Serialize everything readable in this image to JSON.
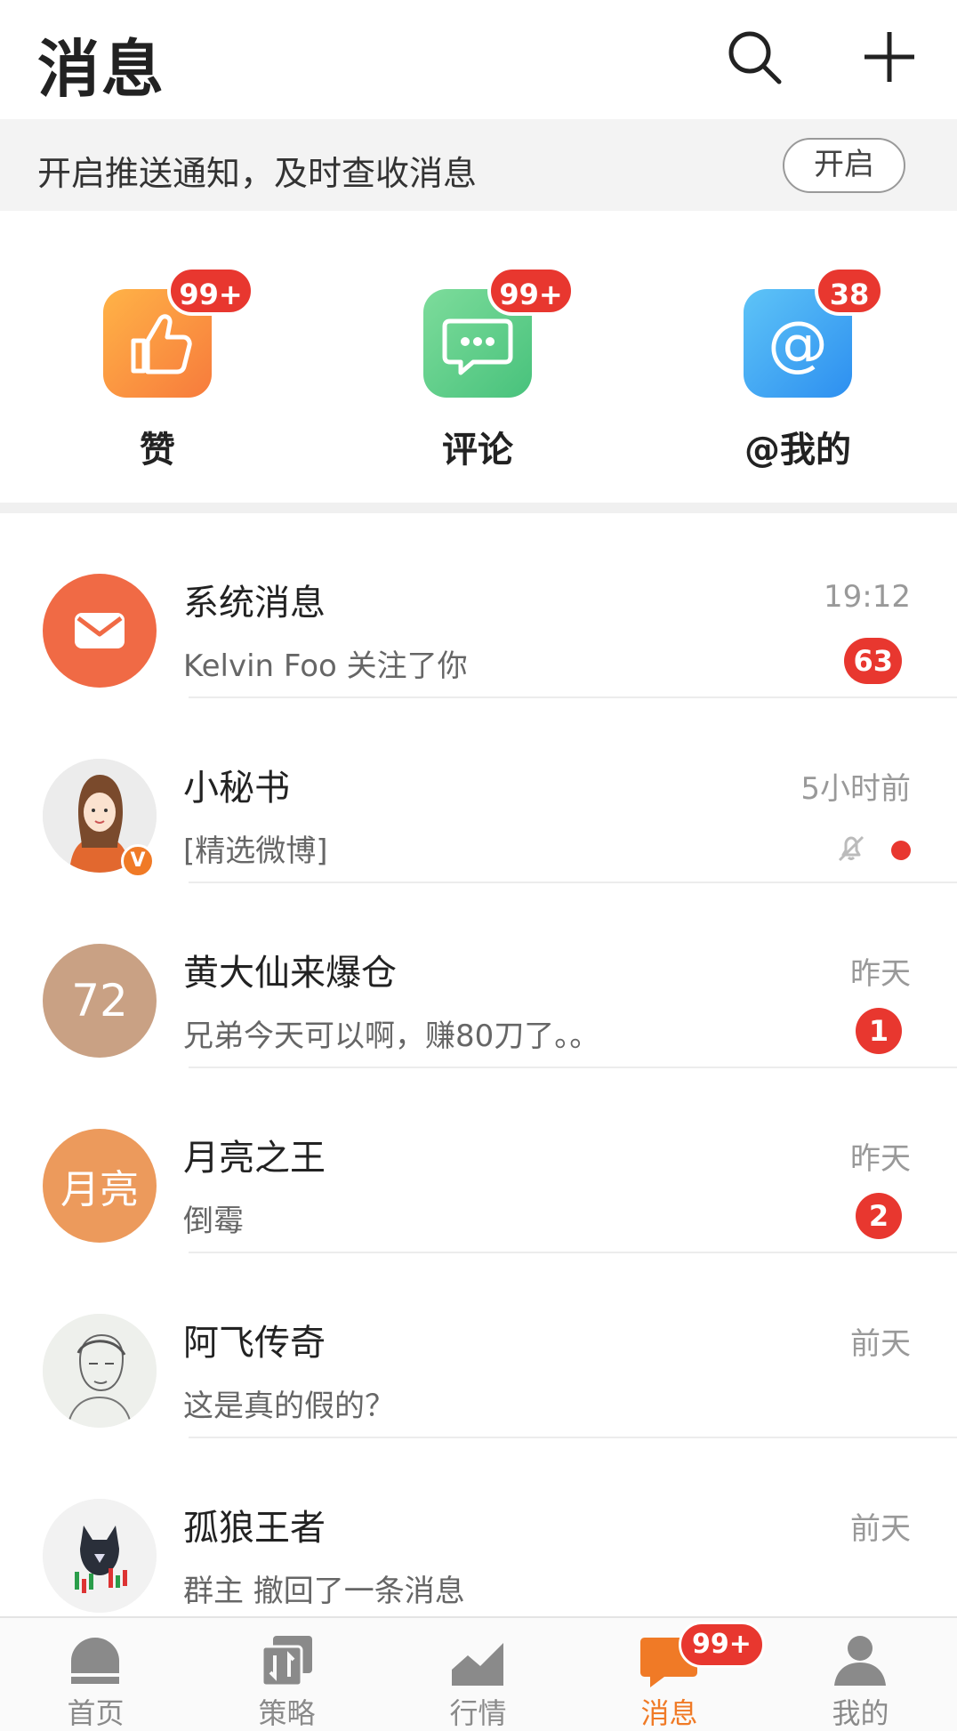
{
  "header": {
    "title": "消息",
    "search_icon": "search-icon",
    "add_icon": "plus-icon"
  },
  "push_banner": {
    "text": "开启推送通知，及时查收消息",
    "button_label": "开启"
  },
  "quick_actions": [
    {
      "label": "赞",
      "badge": "99+",
      "icon": "thumbs-up-icon",
      "color_from": "#ffb347",
      "color_to": "#f77b3c"
    },
    {
      "label": "评论",
      "badge": "99+",
      "icon": "comment-icon",
      "color_from": "#7ddc9b",
      "color_to": "#48c27c"
    },
    {
      "label": "@我的",
      "badge": "38",
      "icon": "at-icon",
      "color_from": "#5ec4f7",
      "color_to": "#2d8ff0"
    }
  ],
  "conversations": [
    {
      "name": "系统消息",
      "preview": "Kelvin Foo 关注了你",
      "time": "19:12",
      "count": "63",
      "avatar": "mail-icon"
    },
    {
      "name": "小秘书",
      "preview": "[精选微博]",
      "time": "5小时前",
      "muted": true,
      "verified": "V",
      "avatar": "girl-portrait"
    },
    {
      "name": "黄大仙来爆仓",
      "preview": "兄弟今天可以啊，赚80刀了。。",
      "time": "昨天",
      "count": "1",
      "avatar_text": "72",
      "avatar_color": "#c9a184"
    },
    {
      "name": "月亮之王",
      "preview": "倒霉",
      "time": "昨天",
      "count": "2",
      "avatar_text": "月亮",
      "avatar_color": "#ec9a5c"
    },
    {
      "name": "阿飞传奇",
      "preview": "这是真的假的？",
      "time": "前天",
      "avatar": "sketch-portrait"
    },
    {
      "name": "孤狼王者",
      "preview": "群主 撤回了一条消息",
      "time": "前天",
      "avatar": "wolf-candlestick"
    }
  ],
  "tabbar": {
    "tabs": [
      {
        "label": "首页",
        "icon": "home-icon"
      },
      {
        "label": "策略",
        "icon": "strategy-icon"
      },
      {
        "label": "行情",
        "icon": "market-icon"
      },
      {
        "label": "消息",
        "icon": "message-icon",
        "badge": "99+",
        "active": true
      },
      {
        "label": "我的",
        "icon": "profile-icon"
      }
    ]
  },
  "colors": {
    "accent": "#f07a26",
    "badge": "#e8372f"
  }
}
